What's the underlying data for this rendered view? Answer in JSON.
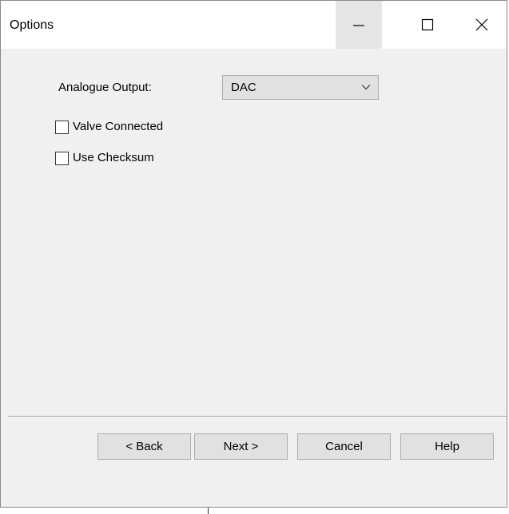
{
  "window": {
    "title": "Options",
    "controls": {
      "minimize": "minimize-icon",
      "maximize": "maximize-icon",
      "close": "close-icon"
    }
  },
  "form": {
    "analogue_output_label": "Analogue Output:",
    "analogue_output_value": "DAC",
    "valve_connected_label": "Valve Connected",
    "valve_connected_checked": false,
    "use_checksum_label": "Use Checksum",
    "use_checksum_checked": false
  },
  "buttons": {
    "back": "< Back",
    "next": "Next >",
    "cancel": "Cancel",
    "help": "Help"
  },
  "colors": {
    "window_bg": "#f0f0f0",
    "titlebar_bg": "#ffffff",
    "button_bg": "#e1e1e1",
    "button_border": "#adadad",
    "minimize_hover_bg": "#e5e5e5"
  }
}
